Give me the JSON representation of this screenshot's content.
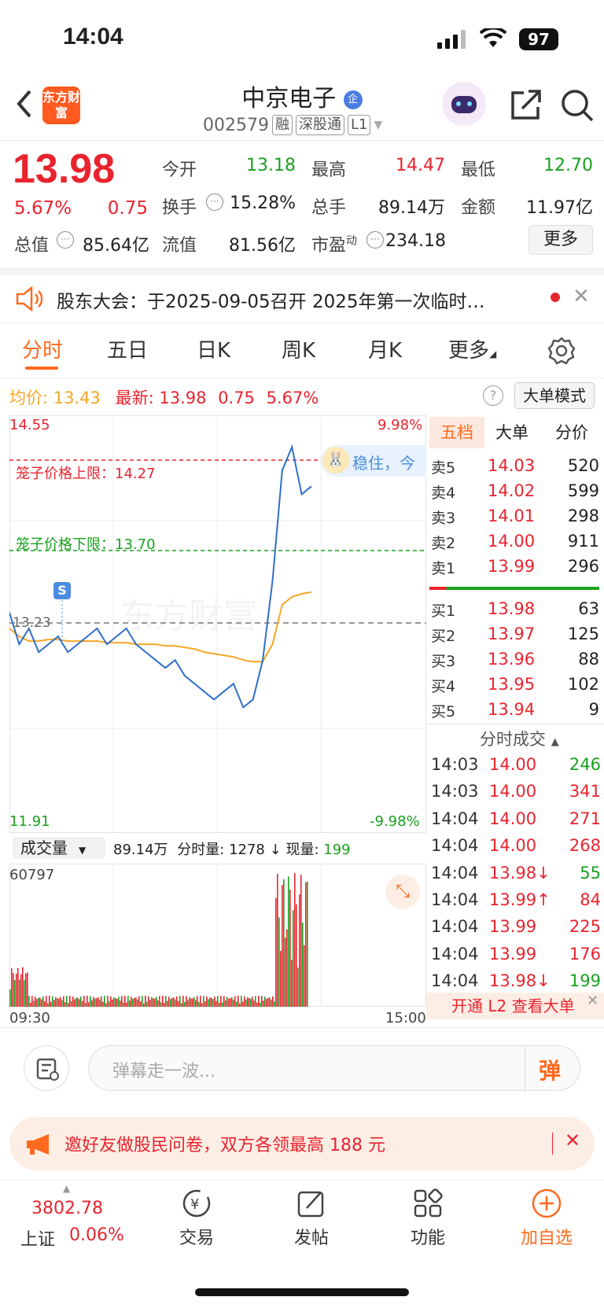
{
  "status": {
    "time": "14:04",
    "battery": "97"
  },
  "header": {
    "name": "中京电子",
    "name_badge": "企",
    "code": "002579",
    "tags": [
      "融",
      "深股通",
      "L1"
    ],
    "logo": "东方财富",
    "icons": [
      "back-icon",
      "robot-avatar-icon",
      "share-icon",
      "search-icon"
    ]
  },
  "quote": {
    "price": "13.98",
    "change_pct": "5.67%",
    "change": "0.75",
    "fields": [
      {
        "label": "今开",
        "value": "13.18",
        "color": "green"
      },
      {
        "label": "最高",
        "value": "14.47",
        "color": "red"
      },
      {
        "label": "最低",
        "value": "12.70",
        "color": "green"
      },
      {
        "label": "换手",
        "value": "15.28%",
        "color": "black"
      },
      {
        "label": "总手",
        "value": "89.14万",
        "color": "black"
      },
      {
        "label": "金额",
        "value": "11.97亿",
        "color": "black"
      },
      {
        "label": "总值",
        "value": "85.64亿",
        "color": "black"
      },
      {
        "label": "流值",
        "value": "81.56亿",
        "color": "black"
      },
      {
        "label": "市盈",
        "sup": "动",
        "value": "234.18",
        "color": "black"
      }
    ],
    "more_button": "更多"
  },
  "notice": {
    "text": "股东大会：于2025-09-05召开 2025年第一次临时…"
  },
  "tabs": [
    "分时",
    "五日",
    "日K",
    "周K",
    "月K",
    "更多"
  ],
  "info_bar": {
    "avg_label": "均价:",
    "avg_value": "13.43",
    "latest_label": "最新:",
    "latest_value": "13.98",
    "change": "0.75",
    "change_pct": "5.67%",
    "mode_button": "大单模式",
    "help": "?"
  },
  "chart": {
    "high_price": "14.55",
    "low_price": "11.91",
    "high_pct": "9.98%",
    "low_pct": "-9.98%",
    "mid_price": "13.23",
    "upper_limit_label": "笼子价格上限：14.27",
    "lower_limit_label": "笼子价格下限：13.70",
    "marker": "S",
    "bubble_text": "稳住，今",
    "watermark": "东方财富"
  },
  "chart_data": {
    "type": "line",
    "ylim": [
      11.91,
      14.55
    ],
    "series": [
      {
        "name": "最新",
        "values": [
          13.3,
          13.1,
          13.2,
          13.05,
          13.1,
          13.15,
          13.05,
          13.1,
          13.15,
          13.2,
          13.1,
          13.15,
          13.2,
          13.1,
          13.05,
          13.0,
          12.95,
          13.0,
          12.9,
          12.85,
          12.8,
          12.75,
          12.8,
          12.85,
          12.7,
          12.75,
          13.0,
          13.5,
          14.2,
          14.35,
          14.05,
          14.1
        ]
      },
      {
        "name": "均价",
        "values": [
          13.2,
          13.15,
          13.12,
          13.12,
          13.13,
          13.13,
          13.12,
          13.12,
          13.12,
          13.12,
          13.11,
          13.11,
          13.11,
          13.1,
          13.1,
          13.1,
          13.09,
          13.09,
          13.08,
          13.07,
          13.05,
          13.04,
          13.03,
          13.02,
          13.0,
          12.99,
          12.99,
          13.1,
          13.35,
          13.4,
          13.42,
          13.43
        ]
      }
    ]
  },
  "volume": {
    "selector": "成交量",
    "total": "89.14万",
    "minute_label": "分时量:",
    "minute_value": "1278",
    "arrow": "↓",
    "now_label": "现量:",
    "now_value": "199",
    "max_label": "60797",
    "time_start": "09:30",
    "time_end": "15:00"
  },
  "orderbook": {
    "tabs": [
      "五档",
      "大单",
      "分价"
    ],
    "sells": [
      {
        "label": "卖5",
        "price": "14.03",
        "vol": "520"
      },
      {
        "label": "卖4",
        "price": "14.02",
        "vol": "599"
      },
      {
        "label": "卖3",
        "price": "14.01",
        "vol": "298"
      },
      {
        "label": "卖2",
        "price": "14.00",
        "vol": "911"
      },
      {
        "label": "卖1",
        "price": "13.99",
        "vol": "296"
      }
    ],
    "buys": [
      {
        "label": "买1",
        "price": "13.98",
        "vol": "63"
      },
      {
        "label": "买2",
        "price": "13.97",
        "vol": "125"
      },
      {
        "label": "买3",
        "price": "13.96",
        "vol": "88"
      },
      {
        "label": "买4",
        "price": "13.95",
        "vol": "102"
      },
      {
        "label": "买5",
        "price": "13.94",
        "vol": "9"
      }
    ],
    "ticks_title": "分时成交",
    "ticks": [
      {
        "time": "14:03",
        "price": "14.00",
        "vol": "246",
        "vcolor": "green"
      },
      {
        "time": "14:03",
        "price": "14.00",
        "vol": "341",
        "vcolor": "red"
      },
      {
        "time": "14:04",
        "price": "14.00",
        "vol": "271",
        "vcolor": "red"
      },
      {
        "time": "14:04",
        "price": "14.00",
        "vol": "268",
        "vcolor": "red"
      },
      {
        "time": "14:04",
        "price": "13.98↓",
        "vol": "55",
        "vcolor": "green"
      },
      {
        "time": "14:04",
        "price": "13.99↑",
        "vol": "84",
        "vcolor": "red"
      },
      {
        "time": "14:04",
        "price": "13.99",
        "vol": "225",
        "vcolor": "red"
      },
      {
        "time": "14:04",
        "price": "13.99",
        "vol": "176",
        "vcolor": "red"
      },
      {
        "time": "14:04",
        "price": "13.98↓",
        "vol": "199",
        "vcolor": "green"
      }
    ],
    "l2_banner": "开通 L2 查看大单"
  },
  "comment": {
    "placeholder": "弹幕走一波...",
    "button": "弹"
  },
  "promo": {
    "text": "邀好友做股民问卷，双方各领最高 188 元"
  },
  "bottom_nav": {
    "index_value": "3802.78",
    "index_name": "上证",
    "index_pct": "0.06%",
    "items": [
      "交易",
      "发帖",
      "功能",
      "加自选"
    ]
  }
}
